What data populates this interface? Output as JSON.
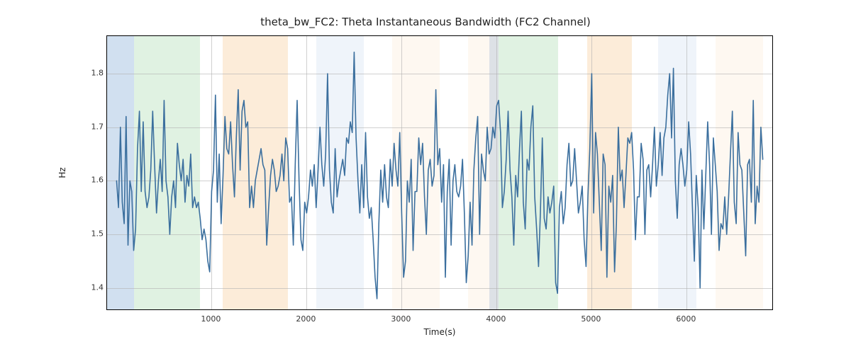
{
  "chart_data": {
    "type": "line",
    "title": "theta_bw_FC2: Theta Instantaneous Bandwidth (FC2 Channel)",
    "xlabel": "Time(s)",
    "ylabel": "Hz",
    "xlim": [
      -100,
      6900
    ],
    "ylim": [
      1.36,
      1.87
    ],
    "xticks": [
      1000,
      2000,
      3000,
      4000,
      5000,
      6000
    ],
    "yticks": [
      1.4,
      1.5,
      1.6,
      1.7,
      1.8
    ],
    "spans": [
      {
        "x0": -100,
        "x1": 180,
        "color": "blue"
      },
      {
        "x0": 180,
        "x1": 880,
        "color": "green"
      },
      {
        "x0": 1120,
        "x1": 1800,
        "color": "orange"
      },
      {
        "x0": 2100,
        "x1": 2600,
        "color": "lblue"
      },
      {
        "x0": 2900,
        "x1": 3400,
        "color": "cream"
      },
      {
        "x0": 3700,
        "x1": 4020,
        "color": "cream"
      },
      {
        "x0": 3920,
        "x1": 4020,
        "color": "blue"
      },
      {
        "x0": 4020,
        "x1": 4650,
        "color": "green"
      },
      {
        "x0": 4950,
        "x1": 5420,
        "color": "orange"
      },
      {
        "x0": 5700,
        "x1": 6100,
        "color": "lblue"
      },
      {
        "x0": 6300,
        "x1": 6800,
        "color": "cream"
      }
    ],
    "x": [
      0,
      20,
      40,
      60,
      80,
      100,
      120,
      140,
      160,
      180,
      200,
      220,
      240,
      260,
      280,
      300,
      320,
      340,
      360,
      380,
      400,
      420,
      440,
      460,
      480,
      500,
      520,
      540,
      560,
      580,
      600,
      620,
      640,
      660,
      680,
      700,
      720,
      740,
      760,
      780,
      800,
      820,
      840,
      860,
      880,
      900,
      920,
      940,
      960,
      980,
      1000,
      1020,
      1040,
      1060,
      1080,
      1100,
      1120,
      1140,
      1160,
      1180,
      1200,
      1220,
      1240,
      1260,
      1280,
      1300,
      1320,
      1340,
      1360,
      1380,
      1400,
      1420,
      1440,
      1460,
      1480,
      1500,
      1520,
      1540,
      1560,
      1580,
      1600,
      1620,
      1640,
      1660,
      1680,
      1700,
      1720,
      1740,
      1760,
      1780,
      1800,
      1820,
      1840,
      1860,
      1880,
      1900,
      1920,
      1940,
      1960,
      1980,
      2000,
      2020,
      2040,
      2060,
      2080,
      2100,
      2120,
      2140,
      2160,
      2180,
      2200,
      2220,
      2240,
      2260,
      2280,
      2300,
      2320,
      2340,
      2360,
      2380,
      2400,
      2420,
      2440,
      2460,
      2480,
      2500,
      2520,
      2540,
      2560,
      2580,
      2600,
      2620,
      2640,
      2660,
      2680,
      2700,
      2720,
      2740,
      2760,
      2780,
      2800,
      2820,
      2840,
      2860,
      2880,
      2900,
      2920,
      2940,
      2960,
      2980,
      3000,
      3020,
      3040,
      3060,
      3080,
      3100,
      3120,
      3140,
      3160,
      3180,
      3200,
      3220,
      3240,
      3260,
      3280,
      3300,
      3320,
      3340,
      3360,
      3380,
      3400,
      3420,
      3440,
      3460,
      3480,
      3500,
      3520,
      3540,
      3560,
      3580,
      3600,
      3620,
      3640,
      3660,
      3680,
      3700,
      3720,
      3740,
      3760,
      3780,
      3800,
      3820,
      3840,
      3860,
      3880,
      3900,
      3920,
      3940,
      3960,
      3980,
      4000,
      4020,
      4040,
      4060,
      4080,
      4100,
      4120,
      4140,
      4160,
      4180,
      4200,
      4220,
      4240,
      4260,
      4280,
      4300,
      4320,
      4340,
      4360,
      4380,
      4400,
      4420,
      4440,
      4460,
      4480,
      4500,
      4520,
      4540,
      4560,
      4580,
      4600,
      4620,
      4640,
      4660,
      4680,
      4700,
      4720,
      4740,
      4760,
      4780,
      4800,
      4820,
      4840,
      4860,
      4880,
      4900,
      4920,
      4940,
      4960,
      4980,
      5000,
      5020,
      5040,
      5060,
      5080,
      5100,
      5120,
      5140,
      5160,
      5180,
      5200,
      5220,
      5240,
      5260,
      5280,
      5300,
      5320,
      5340,
      5360,
      5380,
      5400,
      5420,
      5440,
      5460,
      5480,
      5500,
      5520,
      5540,
      5560,
      5580,
      5600,
      5620,
      5640,
      5660,
      5680,
      5700,
      5720,
      5740,
      5760,
      5780,
      5800,
      5820,
      5840,
      5860,
      5880,
      5900,
      5920,
      5940,
      5960,
      5980,
      6000,
      6020,
      6040,
      6060,
      6080,
      6100,
      6120,
      6140,
      6160,
      6180,
      6200,
      6220,
      6240,
      6260,
      6280,
      6300,
      6320,
      6340,
      6360,
      6380,
      6400,
      6420,
      6440,
      6460,
      6480,
      6500,
      6520,
      6540,
      6560,
      6580,
      6600,
      6620,
      6640,
      6660,
      6680,
      6700,
      6720,
      6740,
      6760,
      6780,
      6800
    ],
    "y": [
      1.6,
      1.55,
      1.7,
      1.56,
      1.52,
      1.72,
      1.48,
      1.6,
      1.58,
      1.47,
      1.51,
      1.66,
      1.73,
      1.58,
      1.71,
      1.58,
      1.55,
      1.57,
      1.62,
      1.73,
      1.63,
      1.54,
      1.6,
      1.64,
      1.58,
      1.75,
      1.6,
      1.57,
      1.5,
      1.57,
      1.6,
      1.55,
      1.67,
      1.63,
      1.6,
      1.64,
      1.56,
      1.61,
      1.59,
      1.65,
      1.55,
      1.57,
      1.55,
      1.56,
      1.53,
      1.49,
      1.51,
      1.49,
      1.45,
      1.43,
      1.58,
      1.62,
      1.76,
      1.56,
      1.65,
      1.52,
      1.61,
      1.72,
      1.66,
      1.65,
      1.71,
      1.63,
      1.57,
      1.68,
      1.77,
      1.62,
      1.73,
      1.75,
      1.7,
      1.71,
      1.55,
      1.59,
      1.55,
      1.6,
      1.62,
      1.64,
      1.66,
      1.63,
      1.62,
      1.48,
      1.55,
      1.61,
      1.64,
      1.62,
      1.58,
      1.59,
      1.61,
      1.65,
      1.6,
      1.68,
      1.66,
      1.56,
      1.57,
      1.48,
      1.63,
      1.75,
      1.6,
      1.49,
      1.47,
      1.56,
      1.54,
      1.57,
      1.62,
      1.59,
      1.63,
      1.55,
      1.62,
      1.7,
      1.63,
      1.59,
      1.65,
      1.8,
      1.62,
      1.56,
      1.54,
      1.66,
      1.57,
      1.6,
      1.62,
      1.64,
      1.61,
      1.68,
      1.67,
      1.71,
      1.69,
      1.84,
      1.68,
      1.6,
      1.54,
      1.63,
      1.55,
      1.69,
      1.57,
      1.53,
      1.55,
      1.49,
      1.42,
      1.38,
      1.52,
      1.62,
      1.56,
      1.63,
      1.57,
      1.55,
      1.64,
      1.59,
      1.67,
      1.62,
      1.59,
      1.69,
      1.54,
      1.42,
      1.45,
      1.6,
      1.56,
      1.64,
      1.47,
      1.58,
      1.58,
      1.68,
      1.63,
      1.67,
      1.57,
      1.5,
      1.62,
      1.64,
      1.59,
      1.61,
      1.77,
      1.63,
      1.66,
      1.56,
      1.63,
      1.42,
      1.58,
      1.64,
      1.48,
      1.6,
      1.63,
      1.58,
      1.57,
      1.59,
      1.64,
      1.54,
      1.41,
      1.46,
      1.56,
      1.48,
      1.62,
      1.68,
      1.72,
      1.5,
      1.65,
      1.62,
      1.6,
      1.7,
      1.65,
      1.66,
      1.7,
      1.68,
      1.74,
      1.75,
      1.69,
      1.55,
      1.58,
      1.64,
      1.73,
      1.62,
      1.57,
      1.48,
      1.61,
      1.57,
      1.66,
      1.73,
      1.56,
      1.51,
      1.64,
      1.62,
      1.7,
      1.74,
      1.57,
      1.51,
      1.44,
      1.54,
      1.68,
      1.53,
      1.51,
      1.57,
      1.54,
      1.56,
      1.59,
      1.41,
      1.39,
      1.55,
      1.58,
      1.52,
      1.55,
      1.63,
      1.67,
      1.59,
      1.6,
      1.66,
      1.6,
      1.54,
      1.56,
      1.59,
      1.49,
      1.44,
      1.57,
      1.66,
      1.8,
      1.54,
      1.69,
      1.65,
      1.56,
      1.47,
      1.65,
      1.63,
      1.42,
      1.59,
      1.56,
      1.61,
      1.43,
      1.52,
      1.7,
      1.6,
      1.62,
      1.55,
      1.61,
      1.68,
      1.67,
      1.69,
      1.62,
      1.49,
      1.57,
      1.57,
      1.67,
      1.64,
      1.5,
      1.62,
      1.63,
      1.57,
      1.63,
      1.7,
      1.59,
      1.63,
      1.69,
      1.61,
      1.68,
      1.7,
      1.76,
      1.8,
      1.68,
      1.81,
      1.6,
      1.53,
      1.63,
      1.66,
      1.63,
      1.59,
      1.62,
      1.71,
      1.65,
      1.55,
      1.45,
      1.61,
      1.55,
      1.4,
      1.62,
      1.51,
      1.61,
      1.71,
      1.63,
      1.5,
      1.68,
      1.63,
      1.58,
      1.47,
      1.52,
      1.51,
      1.57,
      1.5,
      1.57,
      1.65,
      1.73,
      1.56,
      1.52,
      1.69,
      1.63,
      1.62,
      1.54,
      1.46,
      1.63,
      1.64,
      1.56,
      1.75,
      1.52,
      1.59,
      1.56,
      1.7,
      1.64
    ]
  }
}
